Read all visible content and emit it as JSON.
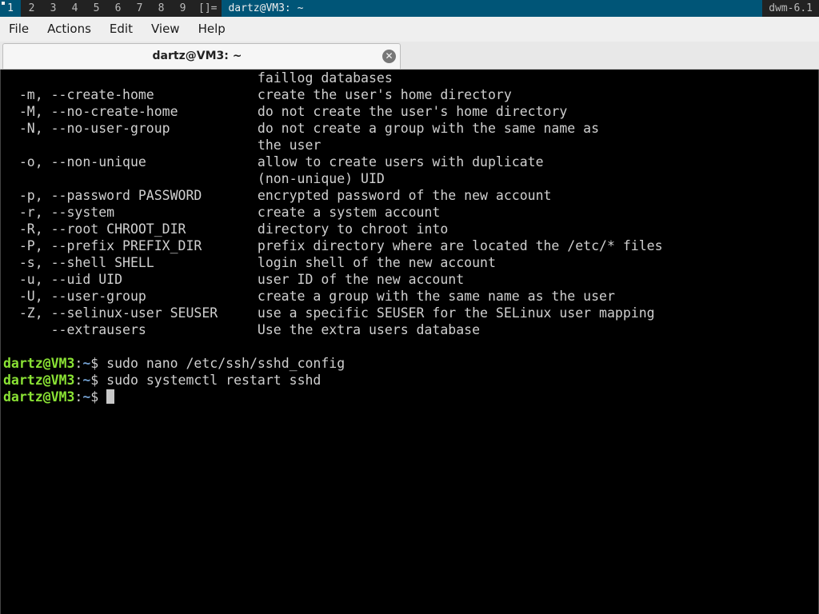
{
  "dwm": {
    "tags": [
      "1",
      "2",
      "3",
      "4",
      "5",
      "6",
      "7",
      "8",
      "9"
    ],
    "selected_tag": "1",
    "layout_symbol": "[]=",
    "window_title": "dartz@VM3: ~",
    "status": "dwm-6.1",
    "colors": {
      "bar_bg": "#222222",
      "selected_bg": "#005577"
    }
  },
  "menubar": {
    "items": [
      "File",
      "Actions",
      "Edit",
      "View",
      "Help"
    ]
  },
  "tab": {
    "title": "dartz@VM3: ~",
    "close_icon": "close-circle-icon"
  },
  "terminal": {
    "output_lines": [
      "                                faillog databases",
      "  -m, --create-home             create the user's home directory",
      "  -M, --no-create-home          do not create the user's home directory",
      "  -N, --no-user-group           do not create a group with the same name as",
      "                                the user",
      "  -o, --non-unique              allow to create users with duplicate",
      "                                (non-unique) UID",
      "  -p, --password PASSWORD       encrypted password of the new account",
      "  -r, --system                  create a system account",
      "  -R, --root CHROOT_DIR         directory to chroot into",
      "  -P, --prefix PREFIX_DIR       prefix directory where are located the /etc/* files",
      "  -s, --shell SHELL             login shell of the new account",
      "  -u, --uid UID                 user ID of the new account",
      "  -U, --user-group              create a group with the same name as the user",
      "  -Z, --selinux-user SEUSER     use a specific SEUSER for the SELinux user mapping",
      "      --extrausers              Use the extra users database",
      ""
    ],
    "prompt": {
      "user_host": "dartz@VM3",
      "separator": ":",
      "path": "~",
      "symbol": "$ "
    },
    "commands": [
      "sudo nano /etc/ssh/sshd_config",
      "sudo systemctl restart sshd",
      ""
    ],
    "colors": {
      "prompt_user": "#8ae234",
      "prompt_path": "#729fcf",
      "text": "#d0d0d0",
      "bg": "#000000"
    }
  }
}
